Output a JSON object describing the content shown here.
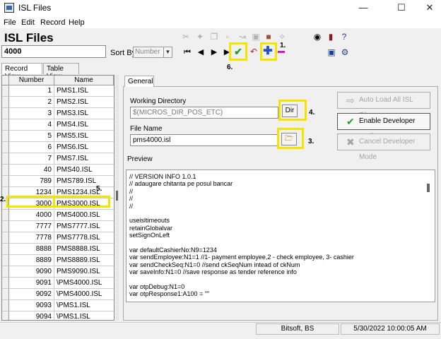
{
  "window": {
    "title": "ISL Files"
  },
  "menu": [
    "File",
    "Edit",
    "Record",
    "Help"
  ],
  "module_title": "ISL Files",
  "record_field": "4000",
  "sort_by": {
    "label": "Sort By",
    "value": "Number"
  },
  "callouts": {
    "one": "1.",
    "two": "2.",
    "three": "3.",
    "four": "4.",
    "five": "5.",
    "six": "6."
  },
  "tabs": {
    "record_view": "Record View",
    "table_view": "Table View"
  },
  "grid": {
    "headers": [
      "Number",
      "Name"
    ],
    "rows": [
      [
        "1",
        "PMS1.ISL"
      ],
      [
        "2",
        "PMS2.ISL"
      ],
      [
        "3",
        "PMS3.ISL"
      ],
      [
        "4",
        "PMS4.ISL"
      ],
      [
        "5",
        "PMS5.ISL"
      ],
      [
        "6",
        "PMS6.ISL"
      ],
      [
        "7",
        "PMS7.ISL"
      ],
      [
        "40",
        "PMS40.ISL"
      ],
      [
        "789",
        "PMS789.ISL"
      ],
      [
        "1234",
        "PMS1234.ISL"
      ],
      [
        "3000",
        "PMS3000.ISL"
      ],
      [
        "4000",
        "PMS4000.ISL"
      ],
      [
        "7777",
        "PMS7777.ISL"
      ],
      [
        "7778",
        "PMS7778.ISL"
      ],
      [
        "8888",
        "PMS8888.ISL"
      ],
      [
        "8889",
        "PMS8889.ISL"
      ],
      [
        "9090",
        "PMS9090.ISL"
      ],
      [
        "9091",
        "\\PMS4000.ISL"
      ],
      [
        "9092",
        "\\PMS4000.ISL"
      ],
      [
        "9093",
        "\\PMS1.ISL"
      ],
      [
        "9094",
        "\\PMS1.ISL"
      ]
    ],
    "selected_row": 11
  },
  "general": {
    "tab": "General",
    "working_dir_label": "Working Directory",
    "working_dir_value": "$(MICROS_DIR_POS_ETC)",
    "dir_button": "Dir",
    "file_name_label": "File Name",
    "file_name_value": "pms4000.isl",
    "auto_load_button": "Auto Load All ISL Files",
    "enable_dev_button": "Enable Developer Mode",
    "cancel_dev_button": "Cancel Developer Mode",
    "preview_label": "Preview"
  },
  "preview_lines": [
    "// VERSION INFO 1.0.1",
    "// adaugare chitanta pe posul bancar",
    "//",
    "//",
    "//",
    "",
    "useisltimeouts",
    "retainGlobalvar",
    "setSignOnLeft",
    "",
    "var defaultCashierNo:N9=1234",
    "var sendEmployee:N1=1 //1- payment employee,2 - check employee, 3- cashier",
    "var sendCheckSeq:N1=0 //send ckSeqNum intead of ckNum",
    "var saveInfo:N1=0 //save response as tender reference info",
    "",
    "var otpDebug:N1=0",
    "var otpResponse1:A100 = \"\"",
    ""
  ],
  "status": {
    "user": "Bitsoft, BS",
    "datetime": "5/30/2022 10:00:05 AM"
  },
  "colors": {
    "highlight": "#f5e400",
    "check_green": "#1e9e2a",
    "plus_blue": "#1f4fd6",
    "minus_magenta": "#d01bbf"
  }
}
